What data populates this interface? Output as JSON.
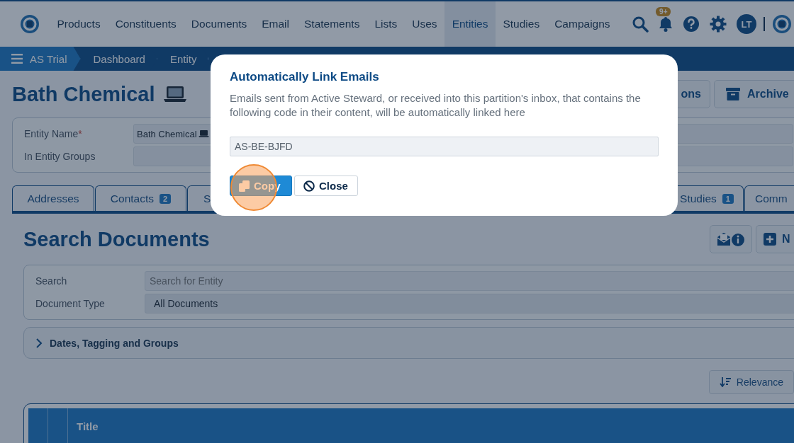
{
  "nav": {
    "items": [
      {
        "label": "Products",
        "selected": false
      },
      {
        "label": "Constituents",
        "selected": false
      },
      {
        "label": "Documents",
        "selected": false
      },
      {
        "label": "Email",
        "selected": false
      },
      {
        "label": "Statements",
        "selected": false
      },
      {
        "label": "Lists",
        "selected": false
      },
      {
        "label": "Uses",
        "selected": false
      },
      {
        "label": "Entities",
        "selected": true
      },
      {
        "label": "Studies",
        "selected": false
      },
      {
        "label": "Campaigns",
        "selected": false
      }
    ],
    "notification_badge": "9+",
    "avatar": "LT"
  },
  "breadcrumbs": [
    {
      "label": "AS Trial",
      "kind": "root"
    },
    {
      "label": "Dashboard",
      "kind": "link"
    },
    {
      "label": "Entity",
      "kind": "link"
    }
  ],
  "entity": {
    "title": "Bath Chemical",
    "fields": [
      {
        "label": "Entity Name",
        "required_mark": "*",
        "value": "Bath Chemical"
      },
      {
        "label": "In Entity Groups"
      }
    ],
    "buttons": [
      {
        "label": "ons",
        "kind": "plain"
      },
      {
        "label": "Archive",
        "kind": "archive"
      }
    ]
  },
  "tabs": [
    {
      "label": "Addresses"
    },
    {
      "label": "Contacts",
      "count": "2"
    },
    {
      "label": "S"
    },
    {
      "label": "Studies",
      "count": "1"
    },
    {
      "label": "Comm"
    }
  ],
  "documents": {
    "title": "Search Documents",
    "new_button": "N",
    "fields": [
      {
        "label": "Search",
        "placeholder": "Search for Entity"
      },
      {
        "label": "Document Type",
        "value": "All Documents"
      }
    ],
    "filters": {
      "label": "Dates, Tagging and Groups",
      "expanded": false
    },
    "sort_button": "Relevance",
    "table": {
      "columns": [
        "Title"
      ]
    }
  },
  "dialog": {
    "title": "Automatically Link Emails",
    "message": "Emails sent from Active Steward, or received into this partition's inbox, that contains the following code in their content, will be automatically linked here",
    "code": "AS-BE-BJFD",
    "buttons": [
      {
        "label": "Copy",
        "kind": "primary"
      },
      {
        "label": "Close",
        "kind": "secondary"
      }
    ],
    "click_marker": true
  }
}
